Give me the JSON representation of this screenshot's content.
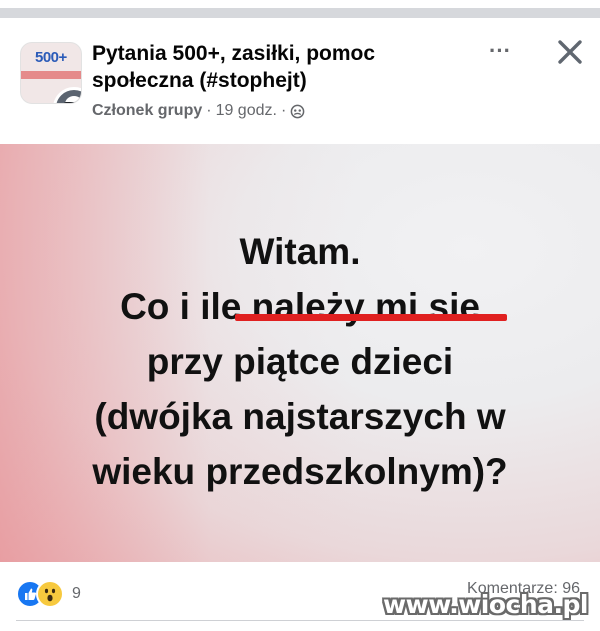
{
  "post": {
    "group_name_line1": "Pytania 500+, zasiłki, pomoc",
    "group_name_line2": "społeczna (#stophejt)",
    "avatar_badge": "500+",
    "member_role": "Członek grupy",
    "separator": "·",
    "time": "19 godz.",
    "separator2": "·",
    "privacy_icon": "group-privacy-icon",
    "more_label": "···",
    "close_icon": "close-icon"
  },
  "image": {
    "lines": [
      "Witam.",
      "Co i ile należy mi sie",
      "przy piątce dzieci",
      "(dwójka najstarszych w",
      "wieku przedszkolnym)?"
    ],
    "underline_color": "#e02020"
  },
  "footer": {
    "reaction_count": "9",
    "reaction_icons": [
      "like-icon",
      "wow-icon"
    ],
    "comments_label": "Komentarze: 96",
    "watermark": "www.wiocha.pl"
  },
  "colors": {
    "like_blue": "#1877f2",
    "wow_yellow": "#f7c93e",
    "secondary_text": "#65676b"
  }
}
